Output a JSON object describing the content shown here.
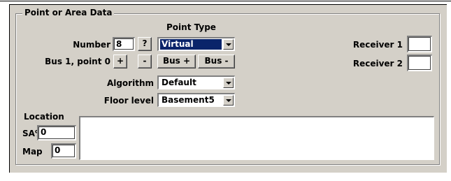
{
  "group": {
    "title": "Point or Area Data"
  },
  "labels": {
    "point_type": "Point Type",
    "number": "Number",
    "bus_point": "Bus 1, point 0",
    "algorithm": "Algorithm",
    "floor_level": "Floor level",
    "receiver1": "Receiver 1",
    "receiver2": "Receiver 2",
    "location": "Location",
    "sa_pct": "SA%",
    "map": "Map"
  },
  "fields": {
    "number": "8",
    "point_type": "Virtual",
    "algorithm": "Default",
    "floor_level": "Basement5",
    "receiver1": "",
    "receiver2": "",
    "sa_pct": "0",
    "map": "0",
    "location": ""
  },
  "buttons": {
    "question": "?",
    "plus": "+",
    "minus": "-",
    "bus_plus": "Bus +",
    "bus_minus": "Bus -"
  },
  "colors": {
    "window": "#d4d0c8",
    "selection": "#0a246a"
  }
}
